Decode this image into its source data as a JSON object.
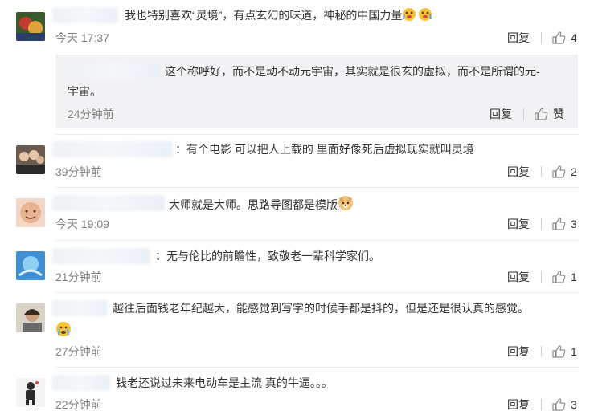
{
  "comments": [
    {
      "text": "我也特别喜欢“灵境”，有点玄幻的味道，神秘的中国力量",
      "time": "今天 17:37",
      "reply": "回复",
      "likes": "4"
    },
    {
      "text": "：有个电影 可以把人上载的 里面好像死后虚拟现实就叫灵境",
      "time": "39分钟前",
      "reply": "回复",
      "likes": "2"
    },
    {
      "text": "大师就是大师。思路导图都是模版",
      "time": "今天 19:09",
      "reply": "回复",
      "likes": "3"
    },
    {
      "text": "：无与伦比的前瞻性，致敬老一辈科学家们。",
      "time": "21分钟前",
      "reply": "回复",
      "likes": "1"
    },
    {
      "text": "越往后面钱老年纪越大，能感觉到写字的时候手都是抖的，但是还是很认真的感觉。",
      "time": "27分钟前",
      "reply": "回复",
      "likes": "1"
    },
    {
      "text": "钱老还说过未来电动车是主流 真的牛逼。。。",
      "time": "22分钟前",
      "reply": "回复",
      "likes": "3"
    }
  ],
  "subreply": {
    "line1": "这个称呼好，而不是动不动元宇宙，其实就是很玄的虚拟，而不是所谓的元-",
    "line2": "宇宙。",
    "time": "24分钟前",
    "reply": "回复",
    "like": "赞"
  },
  "icons": {
    "like": "thumbs-up-icon",
    "accent": "#eb7350"
  }
}
